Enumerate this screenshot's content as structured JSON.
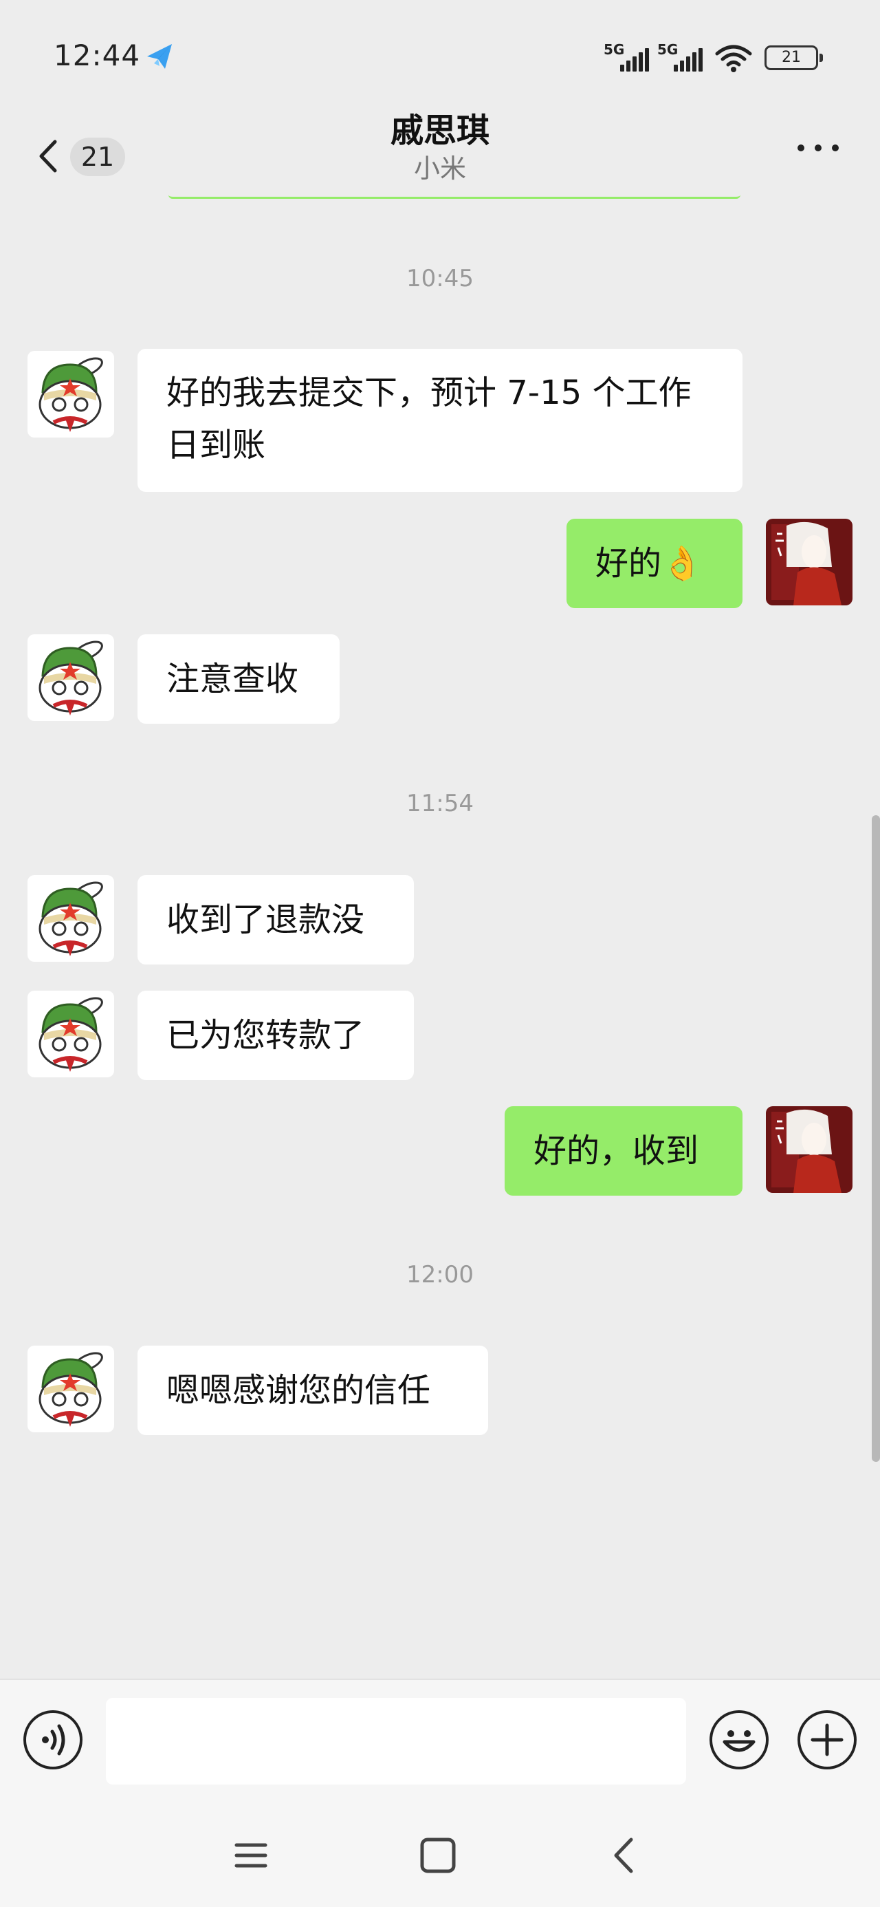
{
  "status_bar": {
    "time": "12:44",
    "signal1_label": "5G",
    "signal2_label": "5G",
    "battery_level": "21"
  },
  "header": {
    "unread_count": "21",
    "title": "戚思琪",
    "subtitle": "小米"
  },
  "messages": [
    {
      "type": "time",
      "text": "10:45"
    },
    {
      "type": "in",
      "line1": "好的我去提交下，预计 7-15 个工作",
      "line2": "日到账"
    },
    {
      "type": "out",
      "text": "好的👌"
    },
    {
      "type": "in",
      "text": "注意查收"
    },
    {
      "type": "time",
      "text": "11:54"
    },
    {
      "type": "in",
      "text": "收到了退款没"
    },
    {
      "type": "in",
      "text": "已为您转款了"
    },
    {
      "type": "out",
      "text": "好的，收到"
    },
    {
      "type": "time",
      "text": "12:00"
    },
    {
      "type": "in",
      "text": "嗯嗯感谢您的信任"
    }
  ],
  "icons": {
    "back": "chevron-left-icon",
    "more": "ellipsis-icon",
    "voice": "voice-icon",
    "emoji": "emoji-icon",
    "plus": "plus-icon",
    "nav_menu": "menu-icon",
    "nav_home": "home-icon",
    "nav_back": "back-icon"
  },
  "colors": {
    "outgoing_bubble": "#95ec69",
    "incoming_bubble": "#ffffff",
    "background": "#ededed"
  }
}
